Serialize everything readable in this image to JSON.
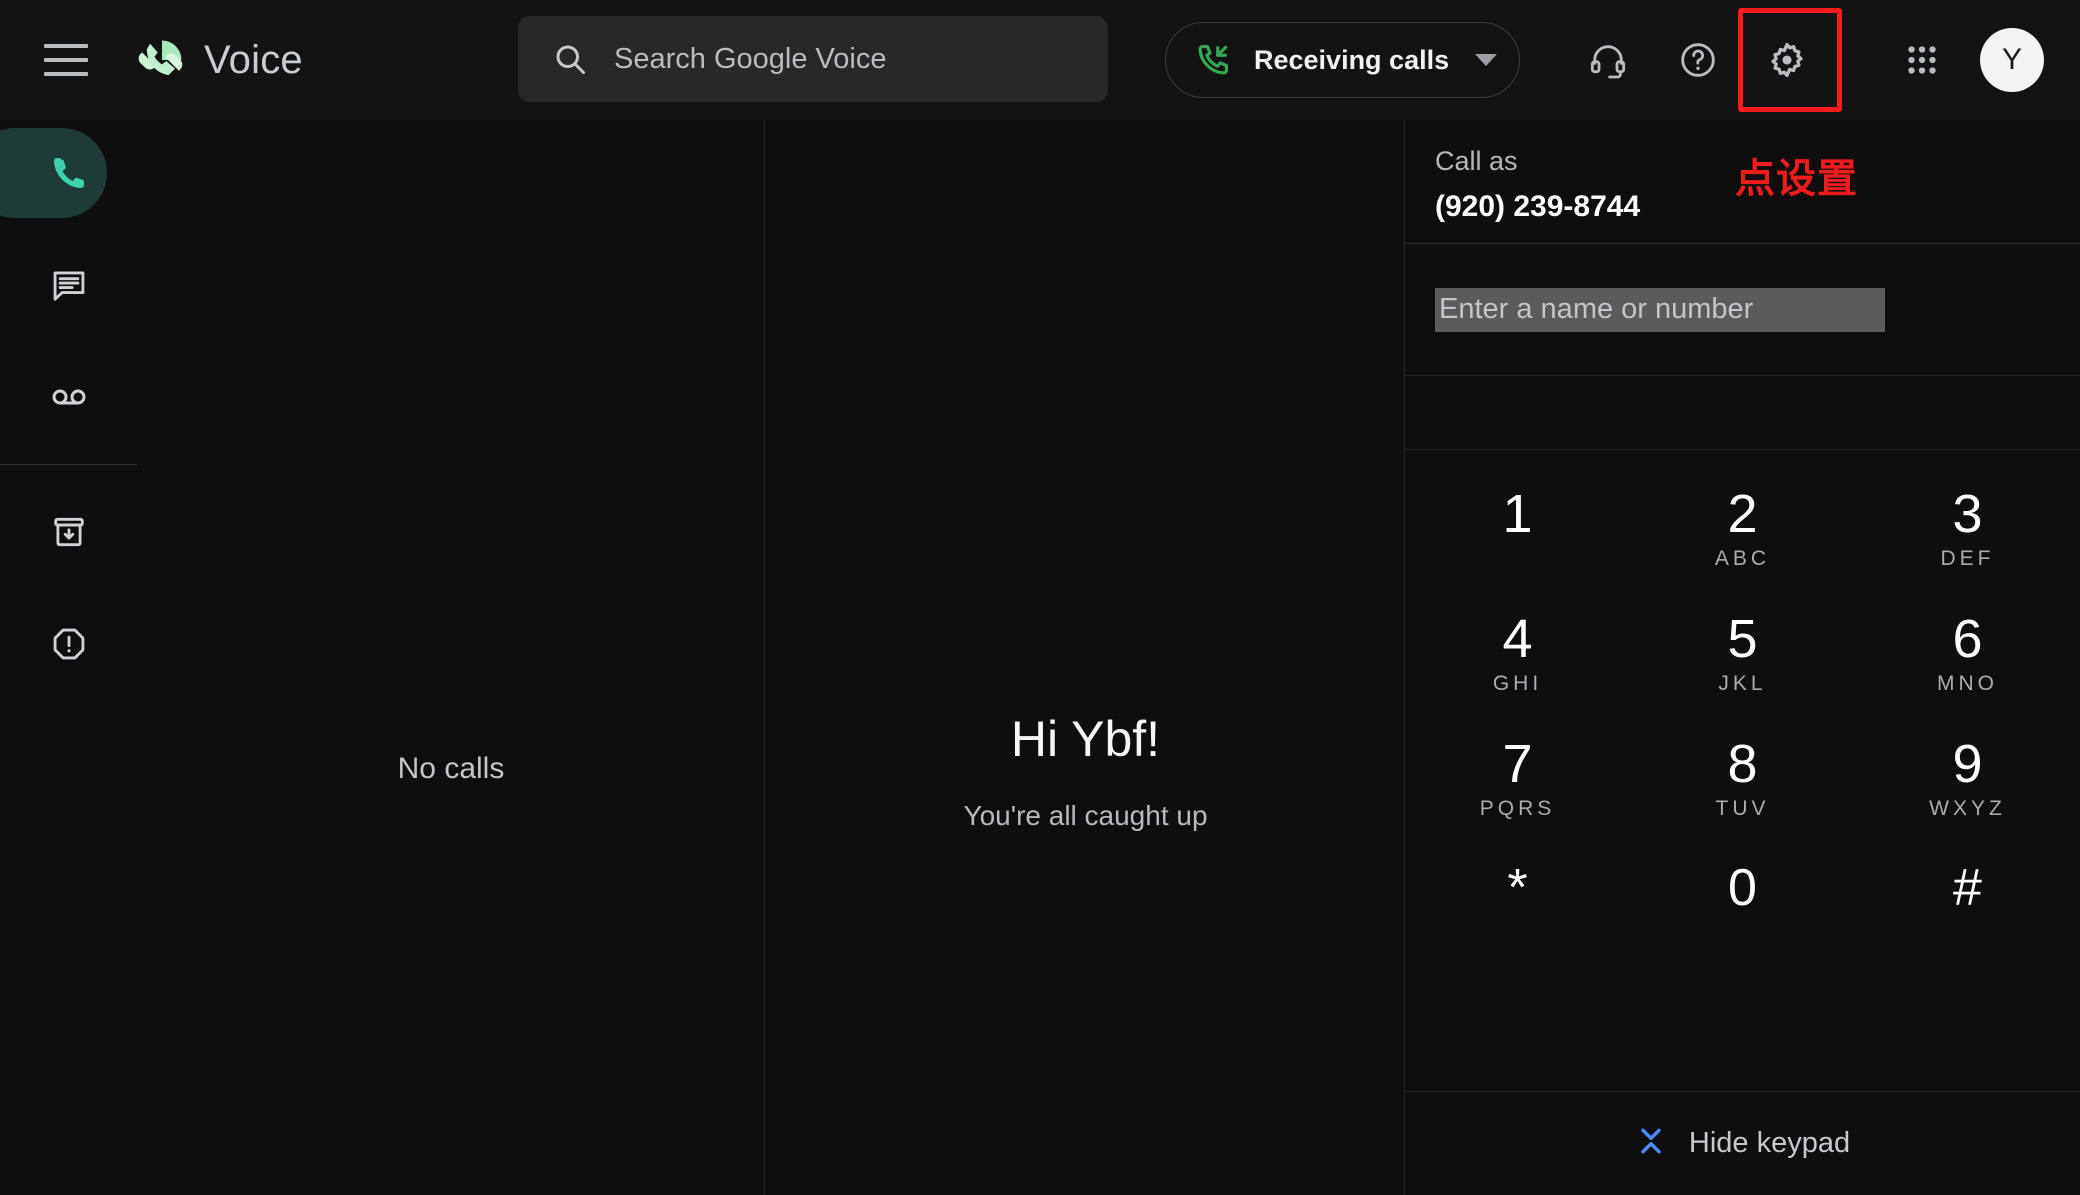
{
  "header": {
    "menu_icon": "hamburger-menu-icon",
    "brand": {
      "logo_icon": "google-voice-logo-icon",
      "name": "Voice"
    },
    "search": {
      "icon": "search-icon",
      "placeholder": "Search Google Voice",
      "value": ""
    },
    "status": {
      "icon": "incoming-call-icon",
      "label": "Receiving calls",
      "caret_icon": "chevron-down-icon"
    },
    "actions": [
      {
        "name": "headset-icon",
        "tooltip": "Headset"
      },
      {
        "name": "help-icon",
        "tooltip": "Help"
      },
      {
        "name": "gear-icon",
        "tooltip": "Settings",
        "highlighted": true
      },
      {
        "name": "apps-grid-icon",
        "tooltip": "Google apps"
      }
    ],
    "avatar": {
      "initial": "Y"
    },
    "highlight_color": "#fb1b1b"
  },
  "sidebar": {
    "items": [
      {
        "icon": "phone-icon",
        "label": "Calls",
        "active": true
      },
      {
        "icon": "message-icon",
        "label": "Messages",
        "active": false
      },
      {
        "icon": "voicemail-icon",
        "label": "Voicemail",
        "active": false
      },
      {
        "icon": "archive-icon",
        "label": "Archived",
        "active": false
      },
      {
        "icon": "spam-icon",
        "label": "Spam",
        "active": false
      }
    ],
    "active_color": "#1f3b37",
    "active_icon_color": "#3ecfad"
  },
  "calls_panel": {
    "empty_text": "No calls"
  },
  "main_panel": {
    "greeting": "Hi Ybf!",
    "subtitle": "You're all caught up"
  },
  "dial_panel": {
    "call_as_label": "Call as",
    "call_as_number": "(920) 239-8744",
    "annotation": "点设置",
    "entry": {
      "placeholder": "Enter a name or number",
      "value": ""
    },
    "call_button_icon": "phone-icon",
    "keypad": [
      [
        {
          "digit": "1",
          "letters": ""
        },
        {
          "digit": "2",
          "letters": "ABC"
        },
        {
          "digit": "3",
          "letters": "DEF"
        }
      ],
      [
        {
          "digit": "4",
          "letters": "GHI"
        },
        {
          "digit": "5",
          "letters": "JKL"
        },
        {
          "digit": "6",
          "letters": "MNO"
        }
      ],
      [
        {
          "digit": "7",
          "letters": "PQRS"
        },
        {
          "digit": "8",
          "letters": "TUV"
        },
        {
          "digit": "9",
          "letters": "WXYZ"
        }
      ],
      [
        {
          "digit": "*",
          "letters": ""
        },
        {
          "digit": "0",
          "letters": ""
        },
        {
          "digit": "#",
          "letters": ""
        }
      ]
    ],
    "hide_keypad": {
      "icon": "collapse-chevrons-icon",
      "label": "Hide keypad",
      "icon_color": "#4c8dfb"
    }
  }
}
